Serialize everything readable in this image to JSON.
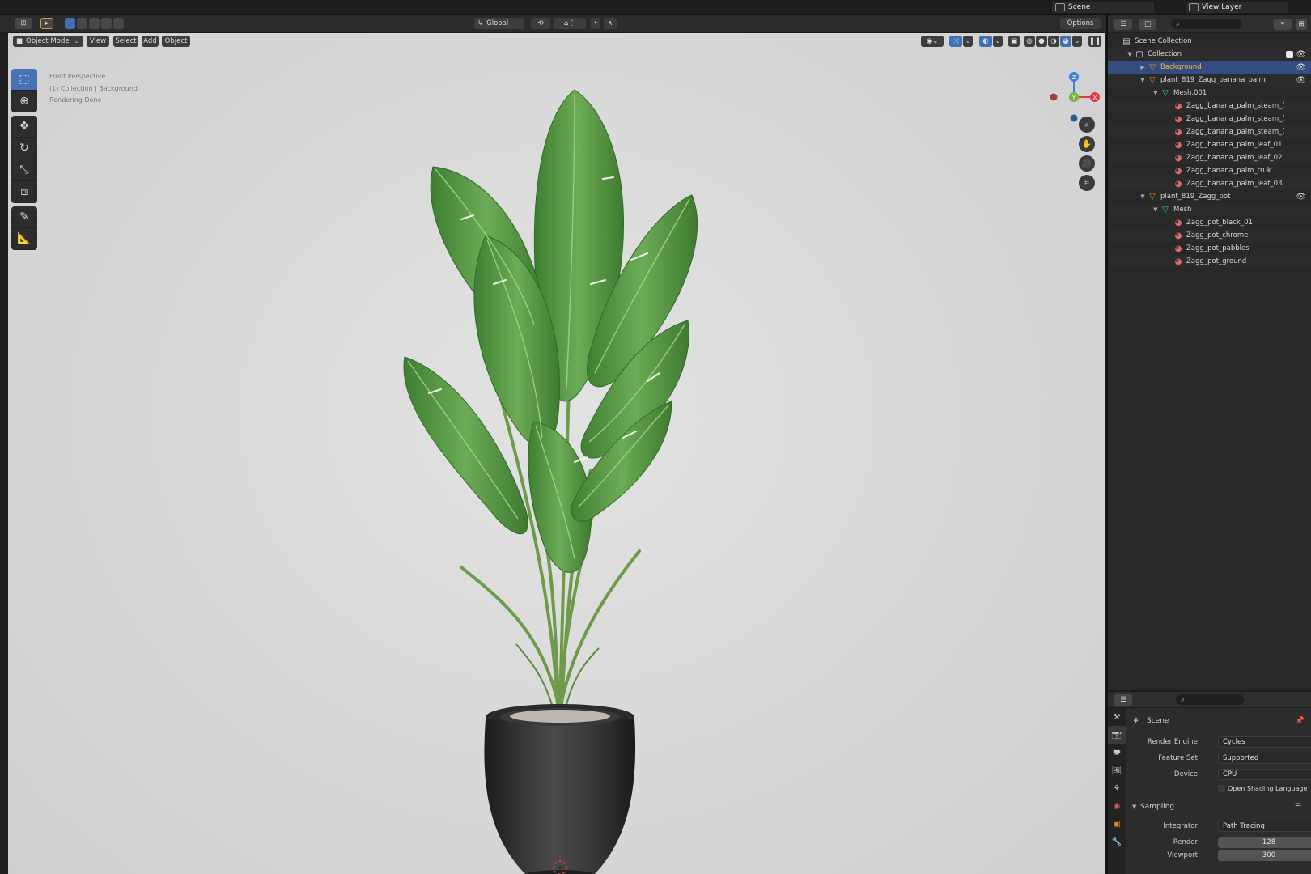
{
  "topbar": {
    "scene_name": "Scene",
    "view_layer": "View Layer"
  },
  "viewport_header": {
    "orientation": "Global",
    "options": "Options",
    "mode": "Object Mode",
    "menus": [
      "View",
      "Select",
      "Add",
      "Object"
    ]
  },
  "viewport": {
    "info_lines": [
      "Front Perspective",
      "(1) Collection | Background",
      "Rendering Done"
    ],
    "gizmo_axes": {
      "z": "Z",
      "y": "Y",
      "x": "X"
    },
    "colors": {
      "x_axis": "#e03a4e",
      "y_axis": "#7bb33a",
      "z_axis": "#3f83d6",
      "selection": "#4772b3"
    }
  },
  "toolbar": {
    "tools": [
      "select-box-icon",
      "cursor-icon",
      "move-icon",
      "rotate-icon",
      "scale-icon",
      "transform-icon",
      "annotate-icon",
      "measure-icon"
    ]
  },
  "outliner": {
    "rows": [
      {
        "label": "Scene Collection",
        "depth": 0,
        "icon": "scene-collection-icon",
        "type": "scene"
      },
      {
        "label": "Collection",
        "depth": 1,
        "icon": "collection-icon",
        "type": "collection"
      },
      {
        "label": "Background",
        "depth": 2,
        "icon": "object-icon",
        "type": "object",
        "selected": true
      },
      {
        "label": "plant_819_Zagg_banana_palm",
        "depth": 2,
        "icon": "object-icon",
        "type": "object"
      },
      {
        "label": "Mesh.001",
        "depth": 3,
        "icon": "mesh-icon",
        "type": "mesh"
      },
      {
        "label": "Zagg_banana_palm_steam_(",
        "depth": 4,
        "icon": "material-icon",
        "type": "material"
      },
      {
        "label": "Zagg_banana_palm_steam_(",
        "depth": 4,
        "icon": "material-icon",
        "type": "material"
      },
      {
        "label": "Zagg_banana_palm_steam_(",
        "depth": 4,
        "icon": "material-icon",
        "type": "material"
      },
      {
        "label": "Zagg_banana_palm_leaf_01",
        "depth": 4,
        "icon": "material-icon",
        "type": "material"
      },
      {
        "label": "Zagg_banana_palm_leaf_02",
        "depth": 4,
        "icon": "material-icon",
        "type": "material"
      },
      {
        "label": "Zagg_banana_palm_truk",
        "depth": 4,
        "icon": "material-icon",
        "type": "material"
      },
      {
        "label": "Zagg_banana_palm_leaf_03",
        "depth": 4,
        "icon": "material-icon",
        "type": "material"
      },
      {
        "label": "plant_819_Zagg_pot",
        "depth": 2,
        "icon": "object-icon",
        "type": "object"
      },
      {
        "label": "Mesh",
        "depth": 3,
        "icon": "mesh-icon",
        "type": "mesh"
      },
      {
        "label": "Zagg_pot_black_01",
        "depth": 4,
        "icon": "material-icon",
        "type": "material"
      },
      {
        "label": "Zagg_pot_chrome",
        "depth": 4,
        "icon": "material-icon",
        "type": "material"
      },
      {
        "label": "Zagg_pot_pabbles",
        "depth": 4,
        "icon": "material-icon",
        "type": "material"
      },
      {
        "label": "Zagg_pot_ground",
        "depth": 4,
        "icon": "material-icon",
        "type": "material"
      }
    ]
  },
  "properties": {
    "context": "Scene",
    "render_engine_label": "Render Engine",
    "render_engine": "Cycles",
    "feature_set_label": "Feature Set",
    "feature_set": "Supported",
    "device_label": "Device",
    "device": "CPU",
    "osl_label": "Open Shading Language",
    "sampling_label": "Sampling",
    "integrator_label": "Integrator",
    "integrator": "Path Tracing",
    "render_label": "Render",
    "render_samples": "128",
    "viewport_label": "Viewport",
    "viewport_samples": "300"
  }
}
